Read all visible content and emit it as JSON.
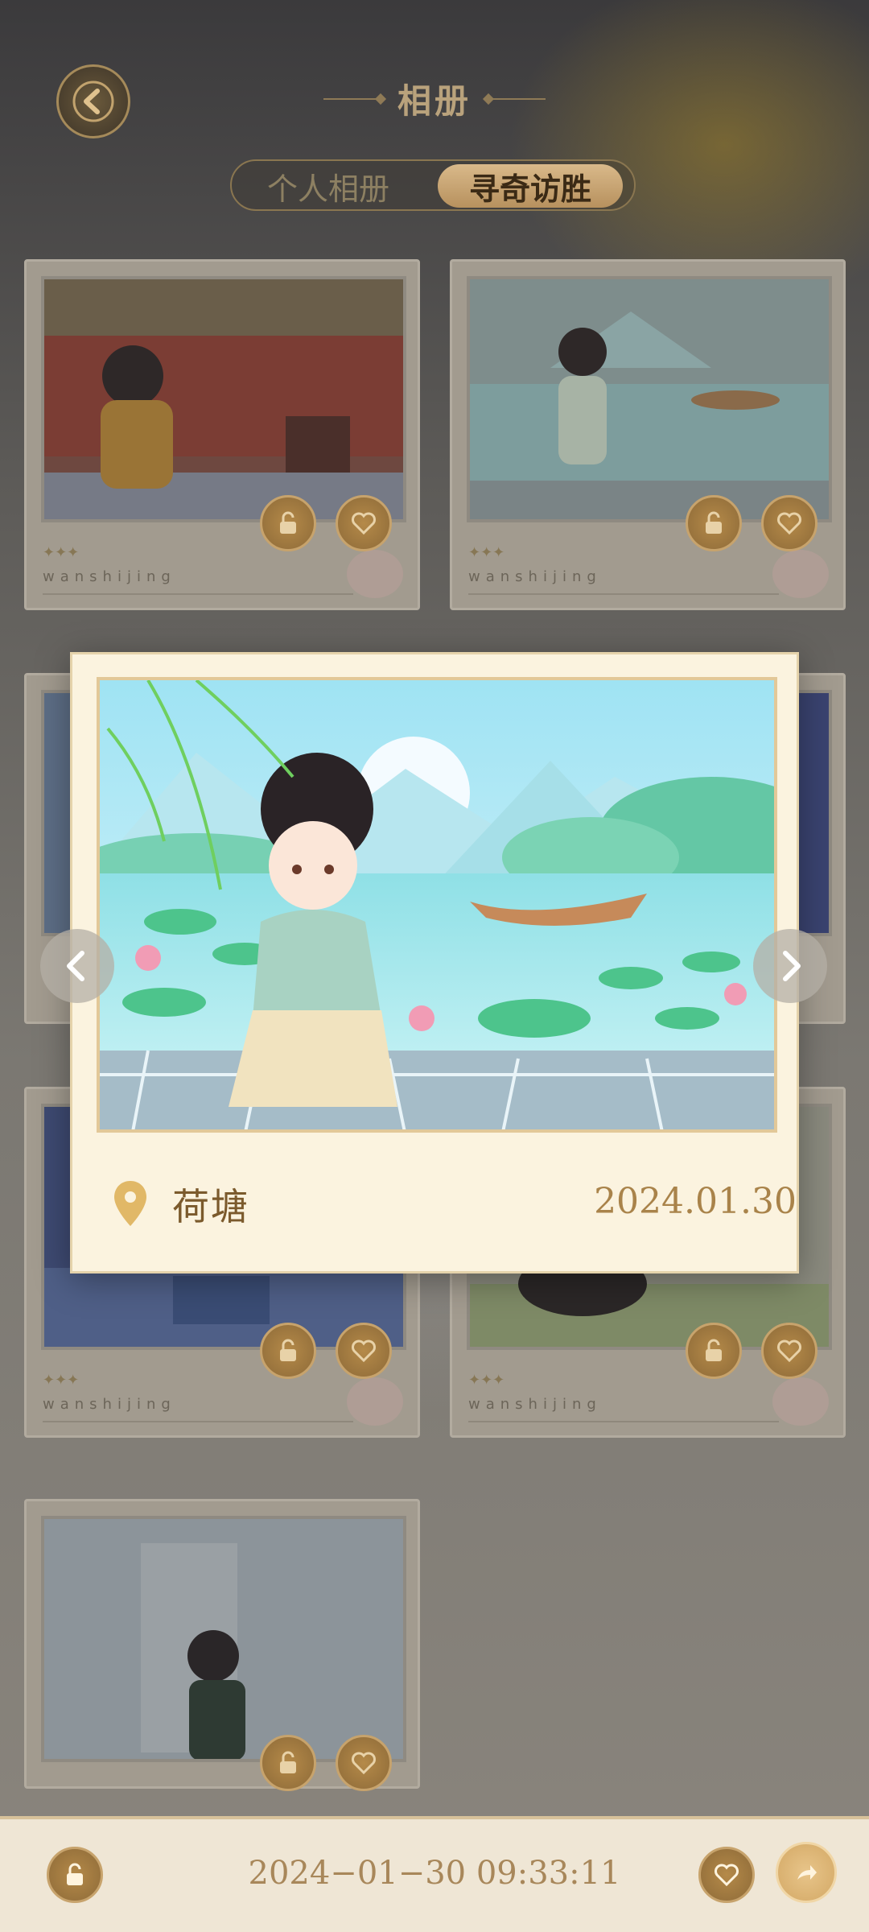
{
  "header": {
    "title": "相册",
    "tabs": [
      {
        "label": "个人相册",
        "active": false
      },
      {
        "label": "寻奇访胜",
        "active": true
      }
    ]
  },
  "cards": [
    {
      "watermark": "wanshijing",
      "stars": "✦✦✦"
    },
    {
      "watermark": "wanshijing",
      "stars": "✦✦✦"
    },
    {
      "watermark": "wanshijing",
      "stars": "✦✦✦"
    },
    {
      "watermark": "wanshijing",
      "stars": "✦✦✦"
    }
  ],
  "dialog": {
    "location": "荷塘",
    "date": "2024.01.30"
  },
  "bottom_bar": {
    "timestamp": "2024−01−30 09:33:11"
  },
  "colors": {
    "accent_gold": "#b7915e",
    "paper": "#fbf3df"
  },
  "icons": [
    "back-arrow-icon",
    "lock-icon",
    "heart-icon",
    "location-pin-icon",
    "share-icon",
    "chevron-left-icon",
    "chevron-right-icon"
  ]
}
